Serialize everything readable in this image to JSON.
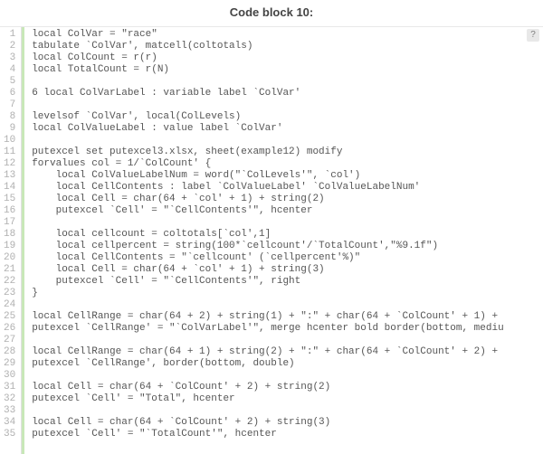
{
  "title": "Code block 10:",
  "help_label": "?",
  "code_lines": [
    "local ColVar = \"race\"",
    "tabulate `ColVar', matcell(coltotals)",
    "local ColCount = r(r)",
    "local TotalCount = r(N)",
    "",
    "6 local ColVarLabel : variable label `ColVar'",
    "",
    "levelsof `ColVar', local(ColLevels)",
    "local ColValueLabel : value label `ColVar'",
    "",
    "putexcel set putexcel3.xlsx, sheet(example12) modify",
    "forvalues col = 1/`ColCount' {",
    "    local ColValueLabelNum = word(\"`ColLevels'\", `col')",
    "    local CellContents : label `ColValueLabel' `ColValueLabelNum'",
    "    local Cell = char(64 + `col' + 1) + string(2)",
    "    putexcel `Cell' = \"`CellContents'\", hcenter",
    "",
    "    local cellcount = coltotals[`col',1]",
    "    local cellpercent = string(100*`cellcount'/`TotalCount',\"%9.1f\")",
    "    local CellContents = \"`cellcount' (`cellpercent'%)\"",
    "    local Cell = char(64 + `col' + 1) + string(3)",
    "    putexcel `Cell' = \"`CellContents'\", right",
    "}",
    "",
    "local CellRange = char(64 + 2) + string(1) + \":\" + char(64 + `ColCount' + 1) + ",
    "putexcel `CellRange' = \"`ColVarLabel'\", merge hcenter bold border(bottom, mediu",
    "",
    "local CellRange = char(64 + 1) + string(2) + \":\" + char(64 + `ColCount' + 2) + ",
    "putexcel `CellRange', border(bottom, double)",
    "",
    "local Cell = char(64 + `ColCount' + 2) + string(2)",
    "putexcel `Cell' = \"Total\", hcenter",
    "",
    "local Cell = char(64 + `ColCount' + 2) + string(3)",
    "putexcel `Cell' = \"`TotalCount'\", hcenter"
  ]
}
